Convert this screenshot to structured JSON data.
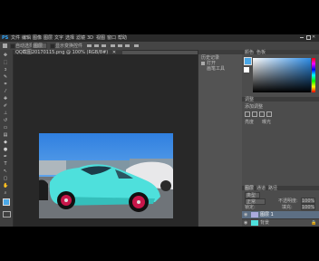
{
  "menu": {
    "items": [
      "PS",
      "文件",
      "编辑",
      "图像",
      "图层",
      "文字",
      "选择",
      "滤镜",
      "3D",
      "视图",
      "窗口",
      "帮助"
    ]
  },
  "options": {
    "label_1": "自动选择:",
    "value_1": "图层",
    "label_2": "显示变换控件"
  },
  "document": {
    "tab_title": "QQ截图20170115.png @ 100% (RGB/8#)"
  },
  "history": {
    "items": [
      "历史记录",
      "打开",
      "画笔工具"
    ]
  },
  "color_panel": {
    "tabs": [
      "颜色",
      "色板"
    ]
  },
  "adjustments": {
    "title": "调整",
    "label_1": "添加调整",
    "row_1": "亮度",
    "row_2": "曝光"
  },
  "layers_panel": {
    "tabs": [
      "图层",
      "通道",
      "路径"
    ],
    "kind_label": "类型",
    "blend_mode": "正常",
    "opacity_label": "不透明度:",
    "opacity_value": "100%",
    "lock_label": "锁定:",
    "fill_label": "填充:",
    "fill_value": "100%",
    "layers": [
      {
        "name": "图层 1"
      },
      {
        "name": "背景"
      }
    ]
  },
  "colors": {
    "app_bg": "#535353",
    "canvas_bg": "#282828",
    "accent": "#2f8ee8",
    "foreground_swatch": "#4aa8e8",
    "background_swatch": "#ffffff"
  }
}
